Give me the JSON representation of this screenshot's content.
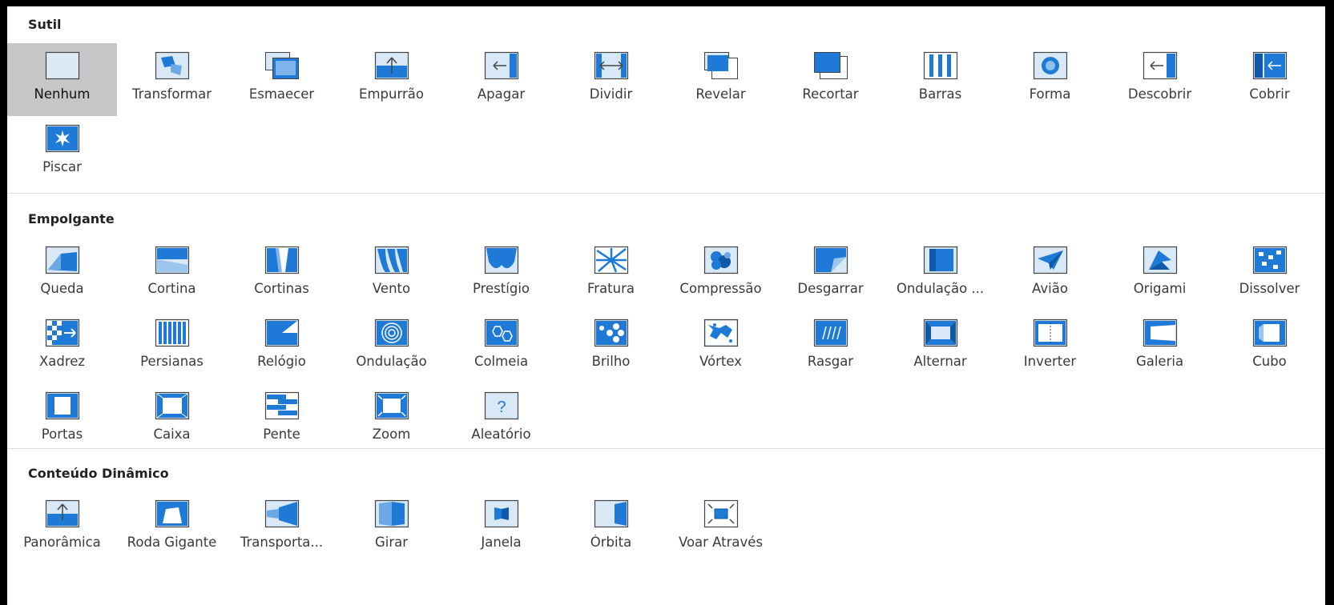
{
  "accent_color": "#1e7ad6",
  "sections": [
    {
      "title": "Sutil",
      "items": [
        {
          "label": "Nenhum",
          "icon": "none",
          "selected": true
        },
        {
          "label": "Transformar",
          "icon": "morph"
        },
        {
          "label": "Esmaecer",
          "icon": "fade"
        },
        {
          "label": "Empurrão",
          "icon": "push"
        },
        {
          "label": "Apagar",
          "icon": "wipe"
        },
        {
          "label": "Dividir",
          "icon": "split"
        },
        {
          "label": "Revelar",
          "icon": "reveal"
        },
        {
          "label": "Recortar",
          "icon": "cut"
        },
        {
          "label": "Barras",
          "icon": "bars"
        },
        {
          "label": "Forma",
          "icon": "shape"
        },
        {
          "label": "Descobrir",
          "icon": "uncover"
        },
        {
          "label": "Cobrir",
          "icon": "cover"
        },
        {
          "label": "Piscar",
          "icon": "flash"
        }
      ]
    },
    {
      "title": "Empolgante",
      "items": [
        {
          "label": "Queda",
          "icon": "fall"
        },
        {
          "label": "Cortina",
          "icon": "drape"
        },
        {
          "label": "Cortinas",
          "icon": "curtains"
        },
        {
          "label": "Vento",
          "icon": "wind"
        },
        {
          "label": "Prestígio",
          "icon": "prestige"
        },
        {
          "label": "Fratura",
          "icon": "fracture"
        },
        {
          "label": "Compressão",
          "icon": "crush"
        },
        {
          "label": "Desgarrar",
          "icon": "peel"
        },
        {
          "label": "Ondulação ...",
          "icon": "page-curl"
        },
        {
          "label": "Avião",
          "icon": "airplane"
        },
        {
          "label": "Origami",
          "icon": "origami"
        },
        {
          "label": "Dissolver",
          "icon": "dissolve"
        },
        {
          "label": "Xadrez",
          "icon": "checkerboard"
        },
        {
          "label": "Persianas",
          "icon": "blinds"
        },
        {
          "label": "Relógio",
          "icon": "clock"
        },
        {
          "label": "Ondulação",
          "icon": "ripple"
        },
        {
          "label": "Colmeia",
          "icon": "honeycomb"
        },
        {
          "label": "Brilho",
          "icon": "glitter"
        },
        {
          "label": "Vórtex",
          "icon": "vortex"
        },
        {
          "label": "Rasgar",
          "icon": "shred"
        },
        {
          "label": "Alternar",
          "icon": "switch"
        },
        {
          "label": "Inverter",
          "icon": "flip"
        },
        {
          "label": "Galeria",
          "icon": "gallery"
        },
        {
          "label": "Cubo",
          "icon": "cube"
        },
        {
          "label": "Portas",
          "icon": "doors"
        },
        {
          "label": "Caixa",
          "icon": "box"
        },
        {
          "label": "Pente",
          "icon": "comb"
        },
        {
          "label": "Zoom",
          "icon": "zoom"
        },
        {
          "label": "Aleatório",
          "icon": "random"
        }
      ]
    },
    {
      "title": "Conteúdo Dinâmico",
      "items": [
        {
          "label": "Panorâmica",
          "icon": "pan"
        },
        {
          "label": "Roda Gigante",
          "icon": "ferris-wheel"
        },
        {
          "label": "Transporta...",
          "icon": "conveyor"
        },
        {
          "label": "Girar",
          "icon": "rotate"
        },
        {
          "label": "Janela",
          "icon": "window"
        },
        {
          "label": "Órbita",
          "icon": "orbit"
        },
        {
          "label": "Voar Através",
          "icon": "fly-through"
        }
      ]
    }
  ]
}
